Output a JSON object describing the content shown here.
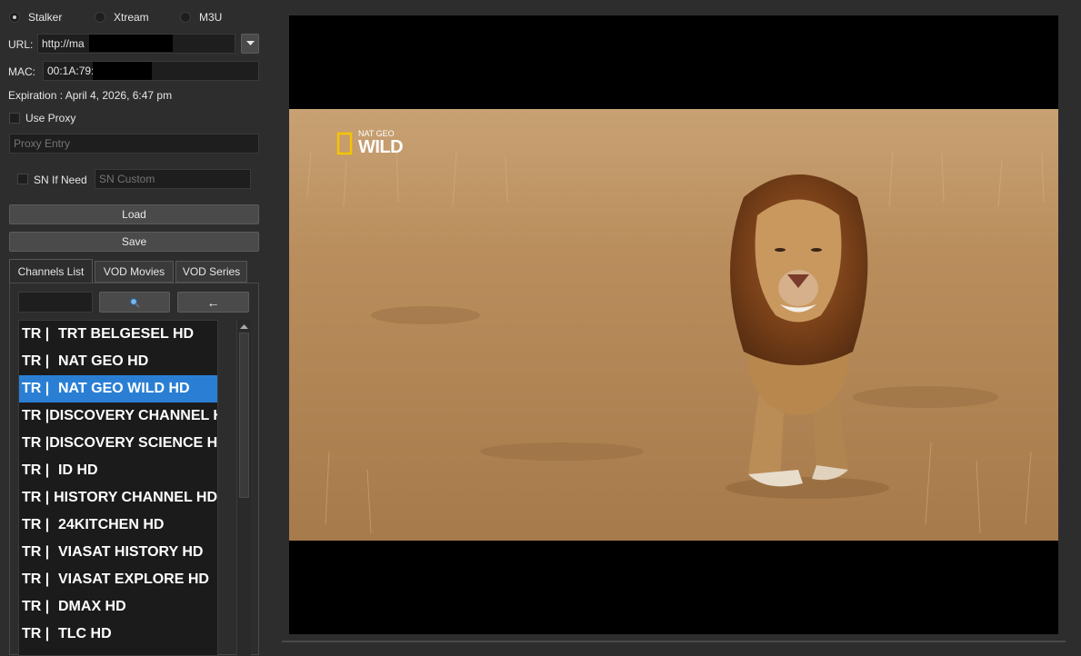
{
  "source_options": [
    {
      "label": "Stalker",
      "checked": true
    },
    {
      "label": "Xtream",
      "checked": false
    },
    {
      "label": "M3U",
      "checked": false
    }
  ],
  "url": {
    "label": "URL:",
    "value": "http://ma"
  },
  "mac": {
    "label": "MAC:",
    "value": "00:1A:79:"
  },
  "expiration": "Expiration : April 4, 2026, 6:47 pm",
  "use_proxy": {
    "label": "Use Proxy",
    "checked": false
  },
  "proxy_entry": {
    "placeholder": "Proxy Entry"
  },
  "sn": {
    "label": "SN If Need",
    "checked": false,
    "placeholder": "SN Custom"
  },
  "buttons": {
    "load": "Load",
    "save": "Save",
    "search": "🔍",
    "back": "←"
  },
  "tabs": [
    {
      "label": "Channels List",
      "active": true
    },
    {
      "label": "VOD Movies",
      "active": false
    },
    {
      "label": "VOD Series",
      "active": false
    }
  ],
  "channels": [
    {
      "prefix": "TR |",
      "name": "TRT BELGESEL HD",
      "selected": false
    },
    {
      "prefix": "TR |",
      "name": "NAT GEO HD",
      "selected": false
    },
    {
      "prefix": "TR |",
      "name": "NAT GEO WILD HD",
      "selected": true
    },
    {
      "prefix": "TR |",
      "name": "DISCOVERY CHANNEL HD",
      "selected": false
    },
    {
      "prefix": "TR |",
      "name": "DISCOVERY SCIENCE HD",
      "selected": false
    },
    {
      "prefix": "TR |",
      "name": "ID HD",
      "selected": false
    },
    {
      "prefix": "TR |",
      "name": "HISTORY CHANNEL HD",
      "selected": false
    },
    {
      "prefix": "TR |",
      "name": "24KITCHEN HD",
      "selected": false
    },
    {
      "prefix": "TR |",
      "name": "VIASAT HISTORY HD",
      "selected": false
    },
    {
      "prefix": "TR |",
      "name": "VIASAT EXPLORE HD",
      "selected": false
    },
    {
      "prefix": "TR |",
      "name": "DMAX HD",
      "selected": false
    },
    {
      "prefix": "TR |",
      "name": "TLC HD",
      "selected": false
    }
  ],
  "video": {
    "logo_top": "NAT GEO",
    "logo_bottom": "WILD",
    "logo_color": "#f5c400"
  }
}
